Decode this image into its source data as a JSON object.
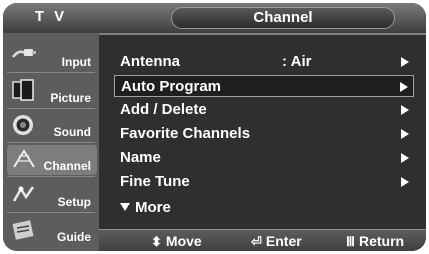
{
  "header": {
    "title_left": "T V",
    "title_center": "Channel"
  },
  "sidebar": {
    "items": [
      {
        "label": "Input",
        "icon": "cable-plug-icon",
        "active": false
      },
      {
        "label": "Picture",
        "icon": "picture-frames-icon",
        "active": false
      },
      {
        "label": "Sound",
        "icon": "speaker-icon",
        "active": false
      },
      {
        "label": "Channel",
        "icon": "antenna-icon",
        "active": true
      },
      {
        "label": "Setup",
        "icon": "setup-icon",
        "active": false
      },
      {
        "label": "Guide",
        "icon": "guide-icon",
        "active": false
      }
    ]
  },
  "menu": {
    "items": [
      {
        "label": "Antenna",
        "value": ": Air",
        "has_arrow": true,
        "selected": false
      },
      {
        "label": "Auto Program",
        "value": "",
        "has_arrow": true,
        "selected": true
      },
      {
        "label": "Add / Delete",
        "value": "",
        "has_arrow": true,
        "selected": false
      },
      {
        "label": "Favorite Channels",
        "value": "",
        "has_arrow": true,
        "selected": false
      },
      {
        "label": "Name",
        "value": "",
        "has_arrow": true,
        "selected": false
      },
      {
        "label": "Fine Tune",
        "value": "",
        "has_arrow": true,
        "selected": false
      }
    ],
    "more_label": "More"
  },
  "bottom_nav": {
    "move": "Move",
    "enter": "Enter",
    "return": "Return"
  },
  "colors": {
    "background": "#000000",
    "panel": "#2f2f2f",
    "sidebar": "#5d5d5d",
    "text": "#ffffff"
  }
}
